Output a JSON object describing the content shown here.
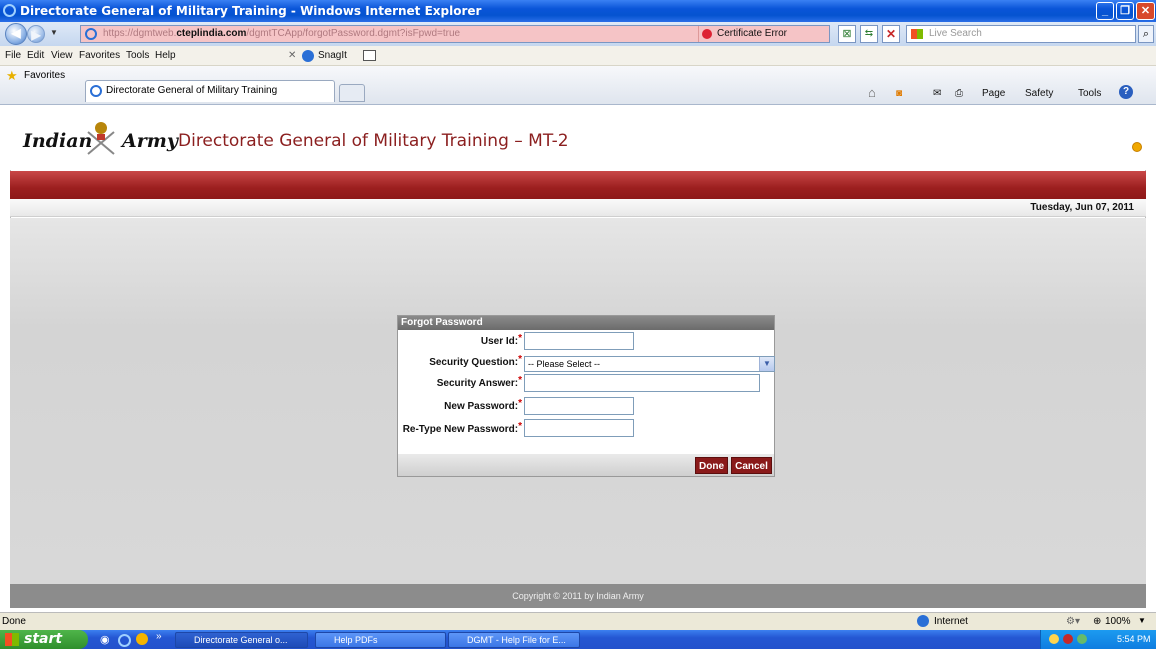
{
  "window": {
    "title": "Directorate General of Military Training - Windows Internet Explorer"
  },
  "address": {
    "url_pre": "https://dgmtweb.",
    "url_host": "cteplindia.com",
    "url_post": "/dgmtTCApp/forgotPassword.dgmt?isFpwd=true",
    "cert_error": "Certificate Error",
    "live_search_placeholder": "Live Search"
  },
  "menu": {
    "file": "File",
    "edit": "Edit",
    "view": "View",
    "favorites": "Favorites",
    "tools": "Tools",
    "help": "Help",
    "snagit": "SnagIt"
  },
  "favbar": {
    "favorites": "Favorites",
    "tab_title": "Directorate General of Military Training"
  },
  "cmdbar": {
    "page": "Page",
    "safety": "Safety",
    "tools": "Tools"
  },
  "site": {
    "brand_left": "Indian",
    "brand_right": "Army",
    "headline": "Directorate General of Military Training – MT-2",
    "date": "Tuesday, Jun 07, 2011",
    "copyright": "Copyright © 2011 by Indian Army"
  },
  "form": {
    "title": "Forgot Password",
    "user_id_label": "User Id:",
    "security_question_label": "Security Question:",
    "security_question_value": "-- Please Select --",
    "security_answer_label": "Security Answer:",
    "new_password_label": "New Password:",
    "retype_password_label": "Re-Type New Password:",
    "required_mark": "*",
    "done": "Done",
    "cancel": "Cancel"
  },
  "status": {
    "left": "Done",
    "zone": "Internet",
    "zoom": "100%"
  },
  "taskbar": {
    "start": "start",
    "task1": "Directorate General o...",
    "task2": "Help PDFs",
    "task3": "DGMT - Help File for E...",
    "clock": "5:54 PM"
  },
  "colors": {
    "brand_red": "#9c1f1f",
    "button_red": "#8a1a1a",
    "headline": "#8b1f1f"
  }
}
